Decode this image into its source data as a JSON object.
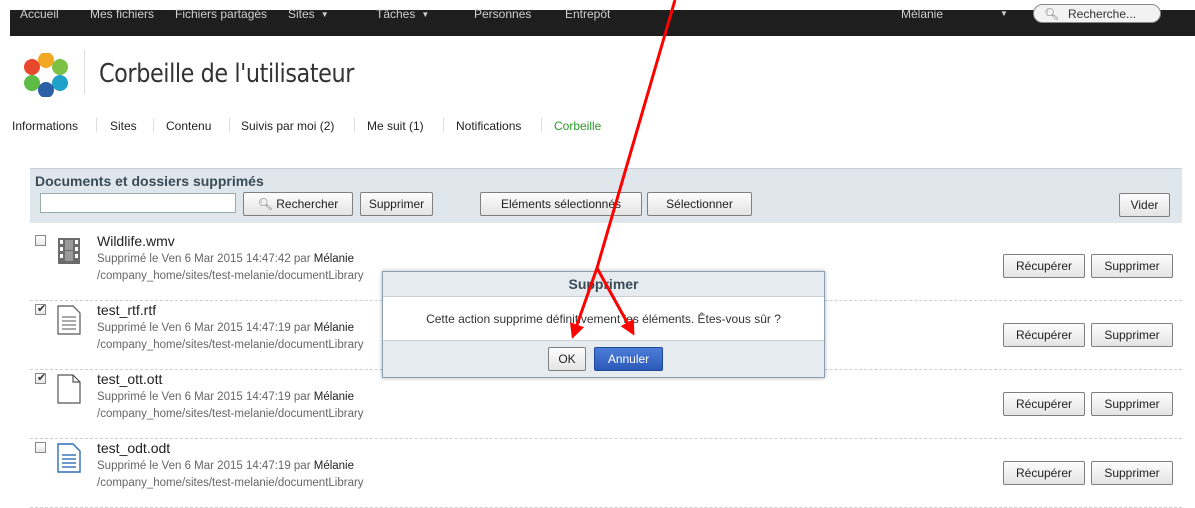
{
  "top_nav": {
    "items": [
      {
        "label": "Accueil"
      },
      {
        "label": "Mes fichiers"
      },
      {
        "label": "Fichiers partagés"
      },
      {
        "label": "Sites",
        "caret": "▼"
      },
      {
        "label": "Tâches",
        "caret": "▼"
      },
      {
        "label": "Personnes"
      },
      {
        "label": "Entrepôt"
      }
    ],
    "user": "Mélanie",
    "user_caret": "▼",
    "search_placeholder": "Recherche..."
  },
  "header": {
    "title": "Corbeille de l'utilisateur"
  },
  "profile_nav": {
    "items": [
      {
        "label": "Informations"
      },
      {
        "label": "Sites"
      },
      {
        "label": "Contenu"
      },
      {
        "label": "Suivis par moi (2)"
      },
      {
        "label": "Me suit (1)"
      },
      {
        "label": "Notifications"
      },
      {
        "label": "Corbeille"
      }
    ],
    "active_color": "#2a9a2a"
  },
  "panel": {
    "title": "Documents et dossiers supprimés",
    "search_button": "Rechercher",
    "delete_button": "Supprimer",
    "selected_items_button": "Eléments sélectionnés",
    "select_button": "Sélectionner",
    "empty_button": "Vider"
  },
  "items": [
    {
      "name": "Wildlife.wmv",
      "meta": "Supprimé le Ven 6 Mar 2015 14:47:42 par",
      "user": "Mélanie",
      "path": "/company_home/sites/test-melanie/documentLibrary",
      "checked": false,
      "icon": "video-icon",
      "recover": "Récupérer",
      "delete": "Supprimer"
    },
    {
      "name": "test_rtf.rtf",
      "meta": "Supprimé le Ven 6 Mar 2015 14:47:19 par",
      "user": "Mélanie",
      "path": "/company_home/sites/test-melanie/documentLibrary",
      "checked": true,
      "icon": "text-document-icon",
      "recover": "Récupérer",
      "delete": "Supprimer"
    },
    {
      "name": "test_ott.ott",
      "meta": "Supprimé le Ven 6 Mar 2015 14:47:19 par",
      "user": "Mélanie",
      "path": "/company_home/sites/test-melanie/documentLibrary",
      "checked": true,
      "icon": "blank-document-icon",
      "recover": "Récupérer",
      "delete": "Supprimer"
    },
    {
      "name": "test_odt.odt",
      "meta": "Supprimé le Ven 6 Mar 2015 14:47:19 par",
      "user": "Mélanie",
      "path": "/company_home/sites/test-melanie/documentLibrary",
      "checked": false,
      "icon": "odt-document-icon",
      "recover": "Récupérer",
      "delete": "Supprimer"
    }
  ],
  "dialog": {
    "title": "Supprimer",
    "message": "Cette action supprime définitivement les éléments. Êtes-vous sûr ?",
    "ok": "OK",
    "cancel": "Annuler"
  },
  "annotation_color": "#ff0000"
}
